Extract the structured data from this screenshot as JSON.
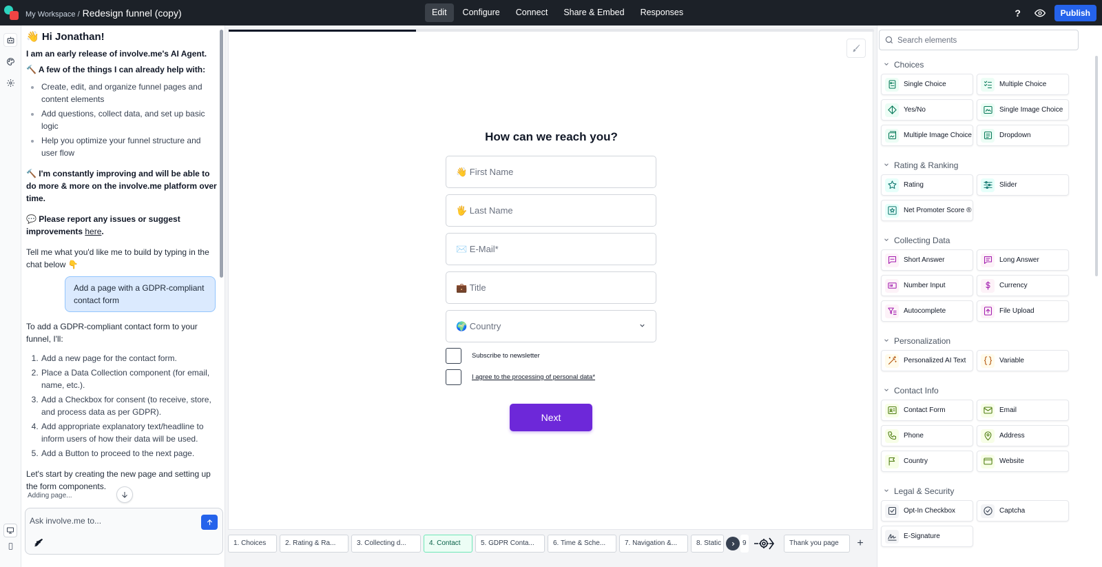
{
  "topbar": {
    "workspace": "My Workspace /",
    "project_title": "Redesign funnel (copy)",
    "nav": [
      "Edit",
      "Configure",
      "Connect",
      "Share & Embed",
      "Responses"
    ],
    "active_nav": "Edit",
    "help": "?",
    "publish": "Publish"
  },
  "chat": {
    "greeting": "👋 Hi Jonathan!",
    "intro": "I am an early release of involve.me's AI Agent.",
    "can_help": "🔨 A few of the things I can already help with:",
    "help_items": [
      "Create, edit, and organize funnel pages and content elements",
      "Add questions, collect data, and set up basic logic",
      "Help you optimize your funnel structure and user flow"
    ],
    "improving": "🔨 I'm constantly improving and will be able to do more & more on the involve.me platform over time.",
    "report_prefix": "💬 Please report any issues or suggest improvements ",
    "report_link": "here",
    "report_suffix": ".",
    "tell_me": "Tell me what you'd like me to build by typing in the chat below 👇",
    "user_message": "Add a page with a GDPR-compliant contact form",
    "reply_intro": "To add a GDPR-compliant contact form to your funnel, I'll:",
    "steps": [
      "Add a new page for the contact form.",
      "Place a Data Collection component (for email, name, etc.).",
      "Add a Checkbox for consent (to receive, store, and process data as per GDPR).",
      "Add appropriate explanatory text/headline to inform users of how their data will be used.",
      "Add a Button to proceed to the next page."
    ],
    "reply_outro": "Let's start by creating the new page and setting up the form components.",
    "status": "Adding page...",
    "input_placeholder": "Ask involve.me to..."
  },
  "canvas": {
    "progress": 0.29,
    "title": "How can we reach you?",
    "fields": [
      "👋 First Name",
      "🖐 Last Name",
      "✉️ E-Mail*",
      "💼 Title"
    ],
    "country_select": "🌍 Country",
    "checkboxes": [
      {
        "label": "Subscribe to newsletter",
        "underlined": false
      },
      {
        "label": "I agree to the processing of personal data*",
        "underlined": true
      }
    ],
    "next_button": "Next"
  },
  "page_tabs": {
    "tabs": [
      "1. Choices",
      "2. Rating & Ra...",
      "3. Collecting d...",
      "4. Contact",
      "5. GDPR Conta...",
      "6. Time & Sche...",
      "7. Navigation &...",
      "8. Static"
    ],
    "active_tab": "4. Contact",
    "overflow_tab": "9",
    "thank_you": "Thank you page",
    "add": "+"
  },
  "elements": {
    "search_placeholder": "Search elements",
    "groups": [
      {
        "title": "Choices",
        "items": [
          {
            "label": "Single Choice",
            "icon": "single-choice-icon",
            "tone": "green"
          },
          {
            "label": "Multiple Choice",
            "icon": "multiple-choice-icon",
            "tone": "green"
          },
          {
            "label": "Yes/No",
            "icon": "yes-no-icon",
            "tone": "green"
          },
          {
            "label": "Single Image Choice",
            "icon": "single-image-choice-icon",
            "tone": "green"
          },
          {
            "label": "Multiple Image Choice",
            "icon": "multiple-image-choice-icon",
            "tone": "green"
          },
          {
            "label": "Dropdown",
            "icon": "dropdown-icon",
            "tone": "green"
          }
        ]
      },
      {
        "title": "Rating & Ranking",
        "items": [
          {
            "label": "Rating",
            "icon": "star-icon",
            "tone": "teal"
          },
          {
            "label": "Slider",
            "icon": "slider-icon",
            "tone": "teal"
          },
          {
            "label": "Net Promoter Score ®",
            "icon": "nps-star-icon",
            "tone": "teal"
          }
        ]
      },
      {
        "title": "Collecting Data",
        "items": [
          {
            "label": "Short Answer",
            "icon": "short-answer-icon",
            "tone": "pink"
          },
          {
            "label": "Long Answer",
            "icon": "long-answer-icon",
            "tone": "pink"
          },
          {
            "label": "Number Input",
            "icon": "number-input-icon",
            "tone": "pink"
          },
          {
            "label": "Currency",
            "icon": "currency-icon",
            "tone": "pink"
          },
          {
            "label": "Autocomplete",
            "icon": "autocomplete-icon",
            "tone": "pink"
          },
          {
            "label": "File Upload",
            "icon": "file-upload-icon",
            "tone": "pink"
          }
        ]
      },
      {
        "title": "Personalization",
        "items": [
          {
            "label": "Personalized AI Text",
            "icon": "magic-wand-icon",
            "tone": "amber"
          },
          {
            "label": "Variable",
            "icon": "curly-braces-icon",
            "tone": "amber"
          }
        ]
      },
      {
        "title": "Contact Info",
        "items": [
          {
            "label": "Contact Form",
            "icon": "contact-card-icon",
            "tone": "lime"
          },
          {
            "label": "Email",
            "icon": "mail-icon",
            "tone": "lime"
          },
          {
            "label": "Phone",
            "icon": "phone-icon",
            "tone": "lime"
          },
          {
            "label": "Address",
            "icon": "map-pin-icon",
            "tone": "lime"
          },
          {
            "label": "Country",
            "icon": "flag-icon",
            "tone": "lime"
          },
          {
            "label": "Website",
            "icon": "browser-icon",
            "tone": "lime"
          }
        ]
      },
      {
        "title": "Legal & Security",
        "items": [
          {
            "label": "Opt-In Checkbox",
            "icon": "checkbox-icon",
            "tone": "gray"
          },
          {
            "label": "Captcha",
            "icon": "captcha-icon",
            "tone": "gray"
          },
          {
            "label": "E-Signature",
            "icon": "signature-icon",
            "tone": "gray"
          }
        ]
      }
    ]
  }
}
